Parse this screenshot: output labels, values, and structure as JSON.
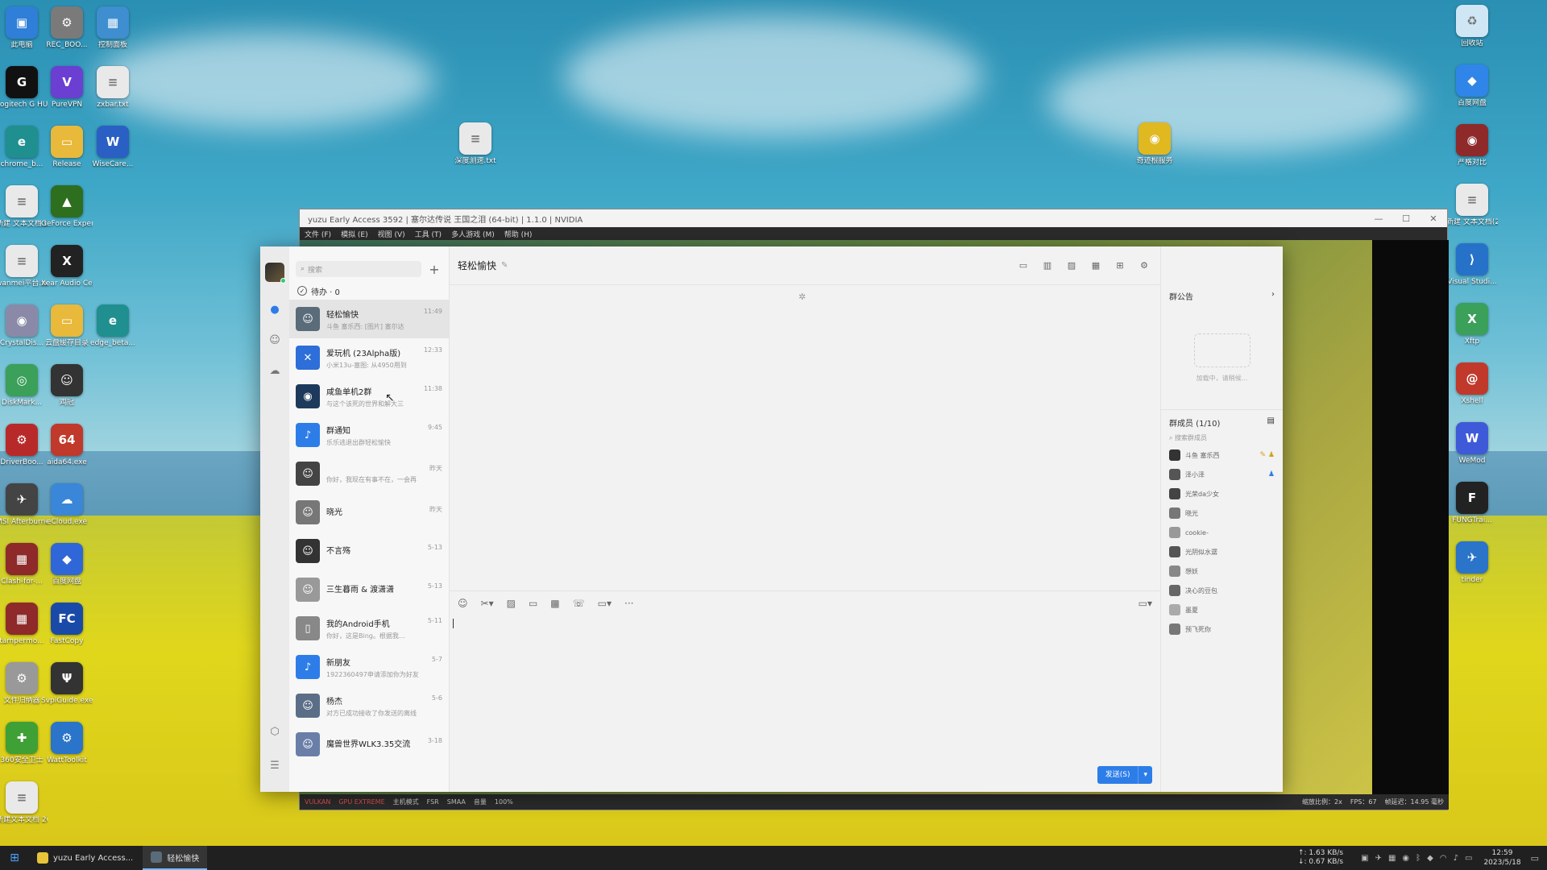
{
  "desktop": {
    "icons_left": [
      {
        "label": "此电脑",
        "color": "#2f7fd8",
        "glyph": "▣"
      },
      {
        "label": "REC_BOO...",
        "color": "#7a7a7a",
        "glyph": "⚙"
      },
      {
        "label": "控制面板",
        "color": "#3e8ed0",
        "glyph": "▦"
      },
      {
        "label": "Logitech G HUB",
        "color": "#111111",
        "glyph": "G"
      },
      {
        "label": "PureVPN",
        "color": "#6a3fd1",
        "glyph": "V"
      },
      {
        "label": "zxbar.txt",
        "color": "#e9e9e9",
        "glyph": "≡"
      },
      {
        "label": "chrome_b...",
        "color": "#1f8f8f",
        "glyph": "e"
      },
      {
        "label": "Release",
        "color": "#e8b93a",
        "glyph": "▭"
      },
      {
        "label": "WiseCare...",
        "color": "#2a5fc4",
        "glyph": "W"
      },
      {
        "label": "新建 文本文档.txt",
        "color": "#e9e9e9",
        "glyph": "≡"
      },
      {
        "label": "GeForce Experience",
        "color": "#2d6e1f",
        "glyph": "▲"
      },
      {
        "label": "wanmei平台.txt",
        "color": "#e9e9e9",
        "glyph": "≡"
      },
      {
        "label": "Xear Audio Center",
        "color": "#222222",
        "glyph": "X"
      },
      {
        "label": "CrystalDis...",
        "color": "#8a8aa8",
        "glyph": "◉"
      },
      {
        "label": "云盘缓存目录",
        "color": "#e8b93a",
        "glyph": "▭"
      },
      {
        "label": "edge_beta...",
        "color": "#1f8f8f",
        "glyph": "e"
      },
      {
        "label": "DiskMark...",
        "color": "#3aa05a",
        "glyph": "◎"
      },
      {
        "label": "鸡冠",
        "color": "#333333",
        "glyph": "☺"
      },
      {
        "label": "DriverBoo...",
        "color": "#b82a2a",
        "glyph": "⚙"
      },
      {
        "label": "aida64.exe",
        "color": "#c0392b",
        "glyph": "64"
      },
      {
        "label": "MSI Afterburner",
        "color": "#444444",
        "glyph": "✈"
      },
      {
        "label": "eCloud.exe",
        "color": "#3a86d8",
        "glyph": "☁"
      },
      {
        "label": "Clash-for-...",
        "color": "#8e2a2a",
        "glyph": "▦"
      },
      {
        "label": "百度网盘",
        "color": "#2f67d8",
        "glyph": "◆"
      },
      {
        "label": "tampermo...",
        "color": "#8e2a2a",
        "glyph": "▦"
      },
      {
        "label": "FastCopy",
        "color": "#1a4aa8",
        "glyph": "FC"
      },
      {
        "label": "文件归纳器",
        "color": "#999999",
        "glyph": "⚙"
      },
      {
        "label": "SvpiGuide.exe",
        "color": "#333333",
        "glyph": "Ψ"
      },
      {
        "label": "360安全卫士",
        "color": "#3fa036",
        "glyph": "✚"
      },
      {
        "label": "WattToolkit",
        "color": "#2a74c9",
        "glyph": "⚙"
      },
      {
        "label": "新建文本文档 2021.txt",
        "color": "#e9e9e9",
        "glyph": "≡"
      }
    ],
    "icons_center": [
      {
        "label": "深度测速.txt",
        "color": "#e9e9e9",
        "glyph": "≡"
      },
      {
        "label": "奇迹根服务",
        "color": "#e0b820",
        "glyph": "◉"
      }
    ],
    "icons_right": [
      {
        "label": "回收站",
        "color": "#cfe6f5",
        "glyph": "♻"
      },
      {
        "label": "百度网盘",
        "color": "#2f86e8",
        "glyph": "◆"
      },
      {
        "label": "严格对比",
        "color": "#8e2a2a",
        "glyph": "◉"
      },
      {
        "label": "新建 文本文档(2).txt",
        "color": "#e9e9e9",
        "glyph": "≡"
      },
      {
        "label": "Visual Studi...",
        "color": "#2672c9",
        "glyph": "⟩"
      },
      {
        "label": "Xftp",
        "color": "#3aa05a",
        "glyph": "X"
      },
      {
        "label": "Xshell",
        "color": "#c0392b",
        "glyph": "@"
      },
      {
        "label": "WeMod",
        "color": "#3f5ad8",
        "glyph": "W"
      },
      {
        "label": "FUNGTrai...",
        "color": "#222222",
        "glyph": "F"
      },
      {
        "label": "tinder",
        "color": "#2a74c9",
        "glyph": "✈"
      }
    ]
  },
  "yuzu": {
    "title": "yuzu Early Access 3592 | 塞尔达传说 王国之泪 (64-bit) | 1.1.0 | NVIDIA",
    "menu": [
      "文件 (F)",
      "模拟 (E)",
      "视图 (V)",
      "工具 (T)",
      "多人游戏 (M)",
      "帮助 (H)"
    ],
    "status_left": [
      "VULKAN",
      "GPU EXTREME",
      "主机模式",
      "FSR",
      "SMAA",
      "音量",
      "100%"
    ],
    "status_right": [
      "缩放比例：2x",
      "FPS：67",
      "帧延迟：14.95 毫秒"
    ]
  },
  "qq": {
    "search_placeholder": "搜索",
    "todo_label": "待办 · 0",
    "chats": [
      {
        "name": "轻松愉快",
        "time": "11:49",
        "preview": "斗鱼 塞乐西: [图片] 塞尔达",
        "color": "#5a6b7a",
        "glyph": "☺",
        "active": true
      },
      {
        "name": "爱玩机 (23Alpha版)",
        "time": "12:33",
        "preview": "小米13u-塞图: 从4950用到",
        "color": "#2d6ed8",
        "glyph": "✕",
        "active": false
      },
      {
        "name": "咸鱼单机2群",
        "time": "11:38",
        "preview": "与这个该死的世界和解大三",
        "color": "#1d3a5c",
        "glyph": "◉",
        "active": false
      },
      {
        "name": "群通知",
        "time": "9:45",
        "preview": "乐乐逃退出群轻松愉快",
        "color": "#2d7de8",
        "glyph": "♪",
        "active": false
      },
      {
        "name": "",
        "time": "昨天",
        "preview": "你好，我现在有事不在，一会再",
        "color": "#444444",
        "glyph": "☺",
        "active": false
      },
      {
        "name": "晓光",
        "time": "昨天",
        "preview": "",
        "color": "#777777",
        "glyph": "☺",
        "active": false
      },
      {
        "name": "不言殇",
        "time": "5-13",
        "preview": "",
        "color": "#333333",
        "glyph": "☺",
        "active": false
      },
      {
        "name": "三生暮雨 & 渡潇潇",
        "time": "5-13",
        "preview": "",
        "color": "#999999",
        "glyph": "☺",
        "active": false
      },
      {
        "name": "我的Android手机",
        "time": "5-11",
        "preview": "你好，这是Bing。根据我…",
        "color": "#888888",
        "glyph": "▯",
        "active": false
      },
      {
        "name": "新朋友",
        "time": "5-7",
        "preview": "1922360497申请添加你为好友",
        "color": "#2d7de8",
        "glyph": "♪",
        "active": false
      },
      {
        "name": "杨杰",
        "time": "5-6",
        "preview": "对方已成功接收了你发送的离线",
        "color": "#5b6e88",
        "glyph": "☺",
        "active": false
      },
      {
        "name": "魔兽世界WLK3.35交流",
        "time": "3-18",
        "preview": "",
        "color": "#6a7fa8",
        "glyph": "☺",
        "active": false
      }
    ],
    "main_title": "轻松愉快",
    "send_label": "发送(S)",
    "notice_title": "群公告",
    "notice_tip": "加载中，请稍候...",
    "members_title": "群成员 (1/10)",
    "member_search": "搜索群成员",
    "members": [
      {
        "name": "斗鱼 塞乐西",
        "badge": "owner"
      },
      {
        "name": "泽小泽",
        "badge": "admin"
      },
      {
        "name": "光荣da少女",
        "badge": ""
      },
      {
        "name": "晓光",
        "badge": ""
      },
      {
        "name": "cookie-",
        "badge": ""
      },
      {
        "name": "光阴似水潺",
        "badge": ""
      },
      {
        "name": "想妖",
        "badge": ""
      },
      {
        "name": "决心的豆包",
        "badge": ""
      },
      {
        "name": "墨夏",
        "badge": ""
      },
      {
        "name": "预飞死你",
        "badge": ""
      }
    ]
  },
  "taskbar": {
    "tasks": [
      {
        "label": "yuzu Early Access...",
        "color": "#e8c43a"
      },
      {
        "label": "轻松愉快",
        "color": "#5a6b7a"
      }
    ],
    "net_up": "↑: 1.63 KB/s",
    "net_down": "↓: 0.67 KB/s",
    "time": "12:59",
    "date": "2023/5/18"
  }
}
